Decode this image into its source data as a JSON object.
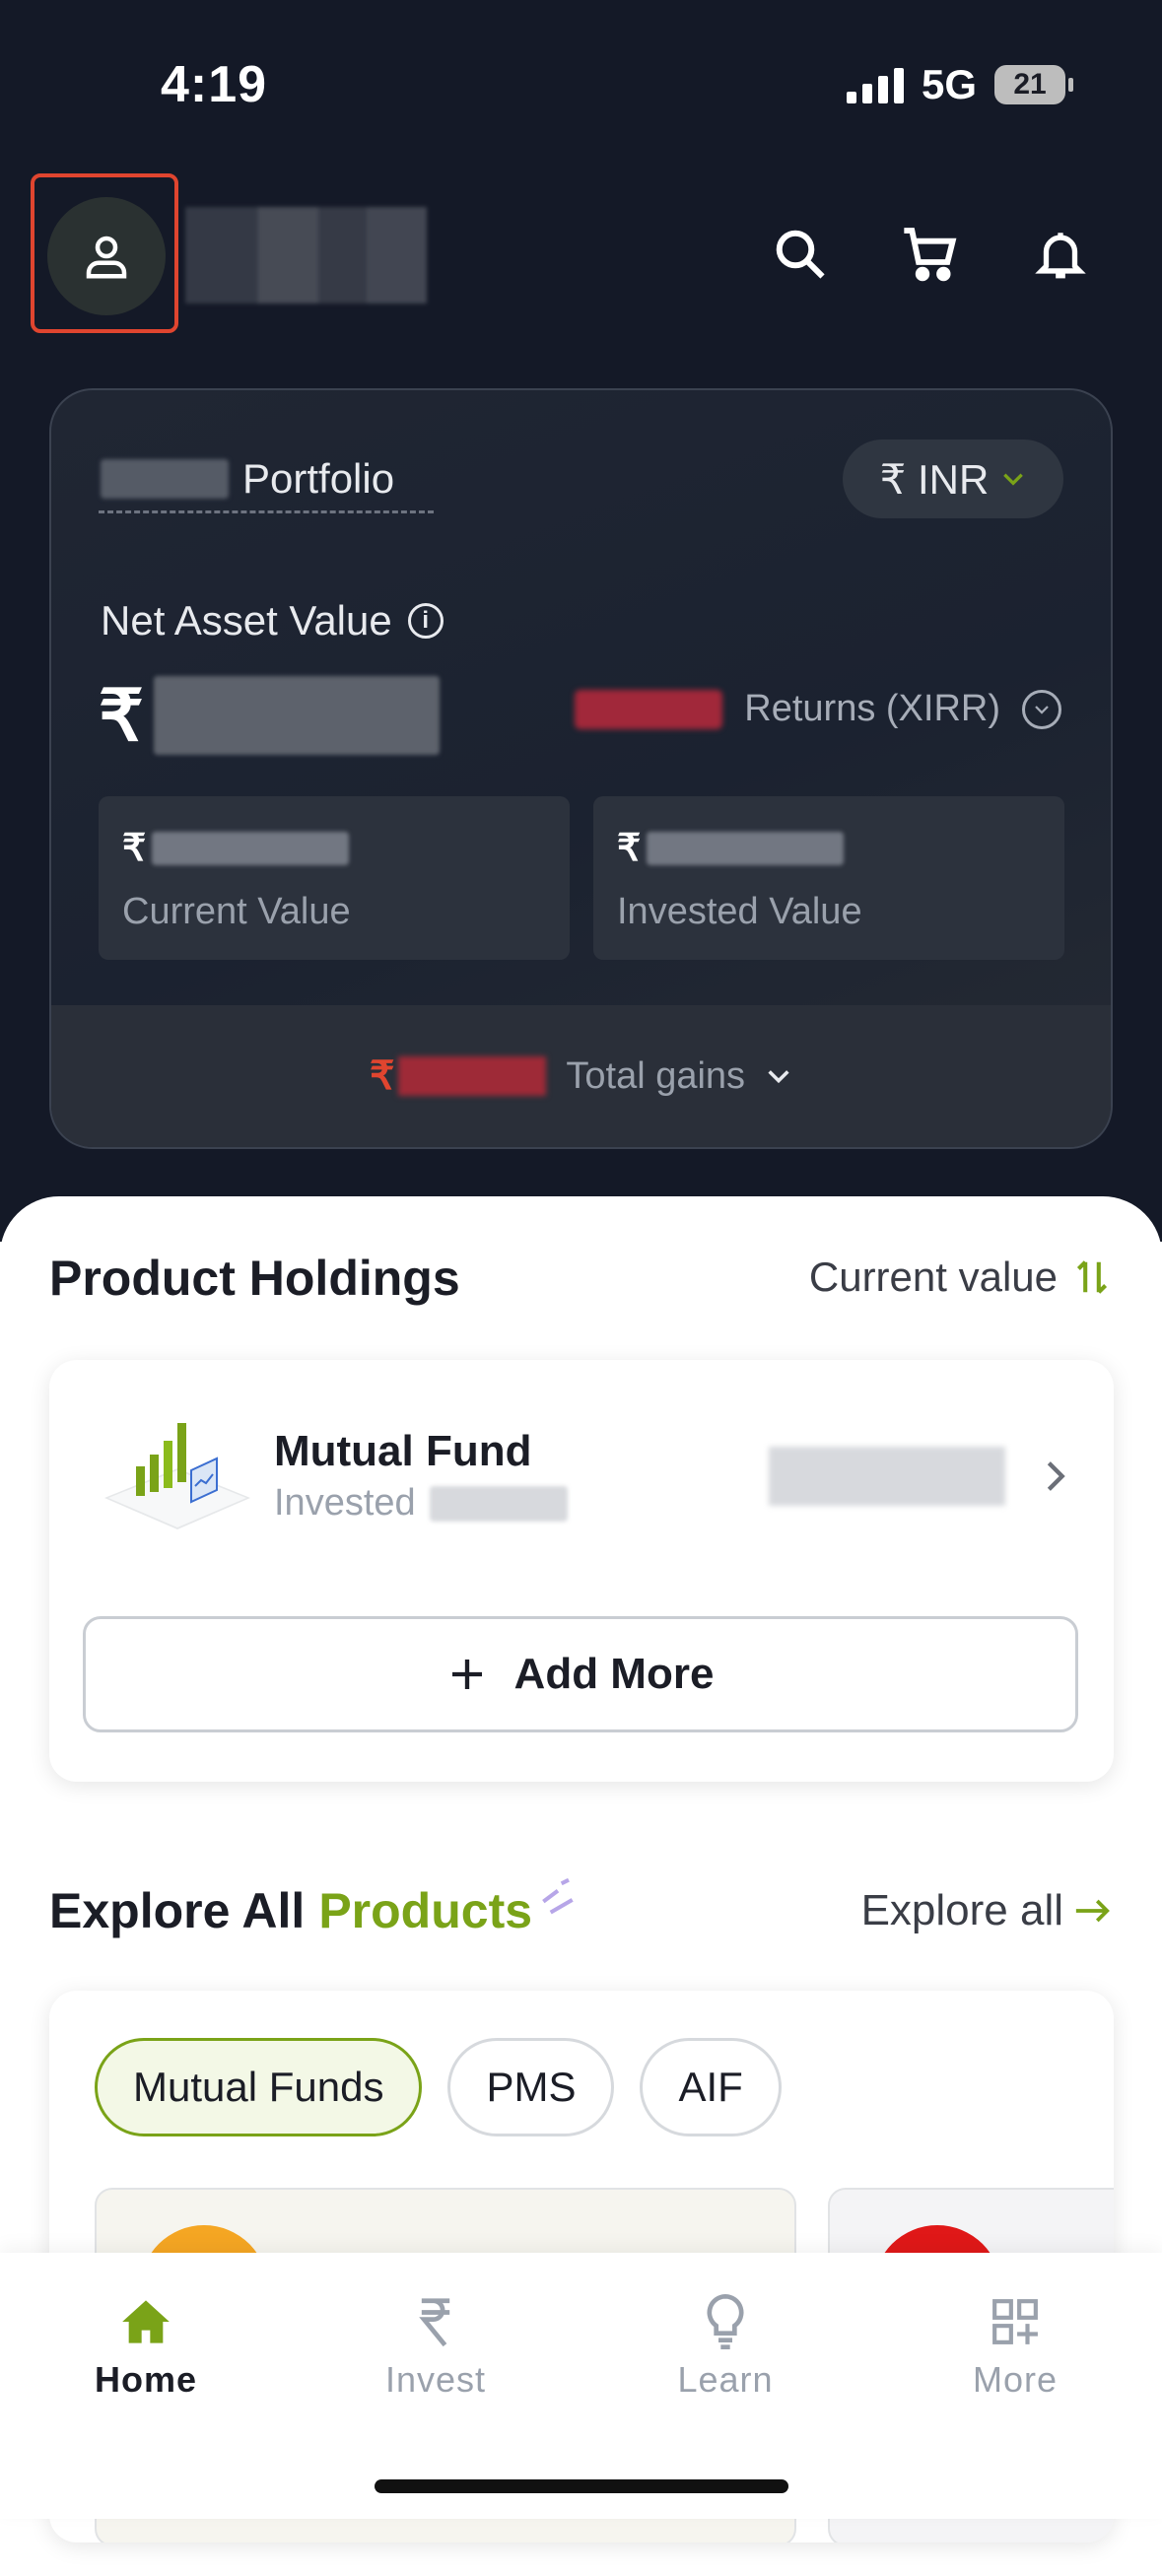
{
  "status_bar": {
    "time": "4:19",
    "network": "5G",
    "battery": "21"
  },
  "portfolio": {
    "label": "Portfolio",
    "currency": "₹ INR",
    "nav_label": "Net Asset Value",
    "rupee": "₹",
    "returns_label": "Returns (XIRR)",
    "current_value_label": "Current Value",
    "invested_value_label": "Invested Value",
    "total_gains_label": "Total gains"
  },
  "holdings": {
    "title": "Product Holdings",
    "sort_label": "Current value",
    "item_title": "Mutual Fund",
    "item_sub": "Invested",
    "add_more": "Add More"
  },
  "explore": {
    "title_a": "Explore All",
    "title_b": "Products",
    "link": "Explore all",
    "chips": [
      "Mutual Funds",
      "PMS",
      "AIF"
    ]
  },
  "bottom_nav": {
    "home": "Home",
    "invest": "Invest",
    "learn": "Learn",
    "more": "More"
  },
  "colors": {
    "accent": "#7aa318",
    "dark_bg": "#141927",
    "highlight_border": "#e0452f"
  }
}
